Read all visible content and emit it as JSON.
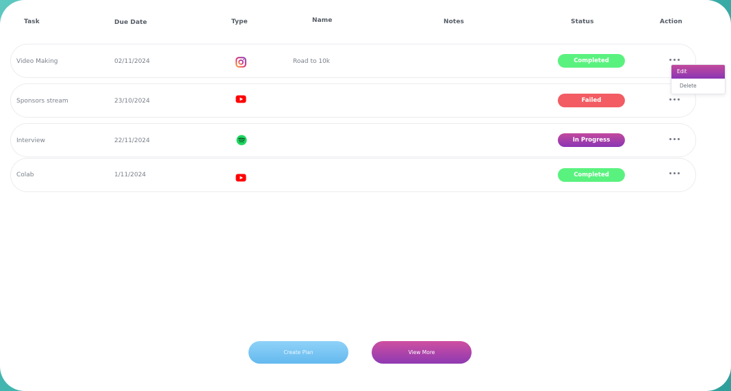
{
  "columns": {
    "task": "Task",
    "due_date": "Due Date",
    "type": "Type",
    "name": "Name",
    "notes": "Notes",
    "status": "Status",
    "action": "Action"
  },
  "rows": [
    {
      "task": "Video Making",
      "due_date": "02/11/2024",
      "type_icon": "instagram-icon",
      "name": "Road to 10k",
      "status": "Completed",
      "status_color": "#5af27f"
    },
    {
      "task": "Sponsors stream",
      "due_date": "23/10/2024",
      "type_icon": "youtube-icon",
      "name": "",
      "status": "Failed",
      "status_color": "#f25c62"
    },
    {
      "task": "Interview",
      "due_date": "22/11/2024",
      "type_icon": "spotify-icon",
      "name": "",
      "status": "In Progress",
      "status_color": "#9a3db0"
    },
    {
      "task": "Colab",
      "due_date": "1/11/2024",
      "type_icon": "youtube-icon",
      "name": "",
      "status": "Completed",
      "status_color": "#5af27f"
    }
  ],
  "action_menu": {
    "edit": "Edit",
    "delete": "Delete"
  },
  "buttons": {
    "create_plan": "Create Plan",
    "view_more": "View More"
  },
  "colors": {
    "background": "#3fb3ad",
    "completed": "#5af27f",
    "failed": "#f25c62",
    "in_progress": "#9a3db0",
    "accent_blue": "#7cc6f4"
  }
}
